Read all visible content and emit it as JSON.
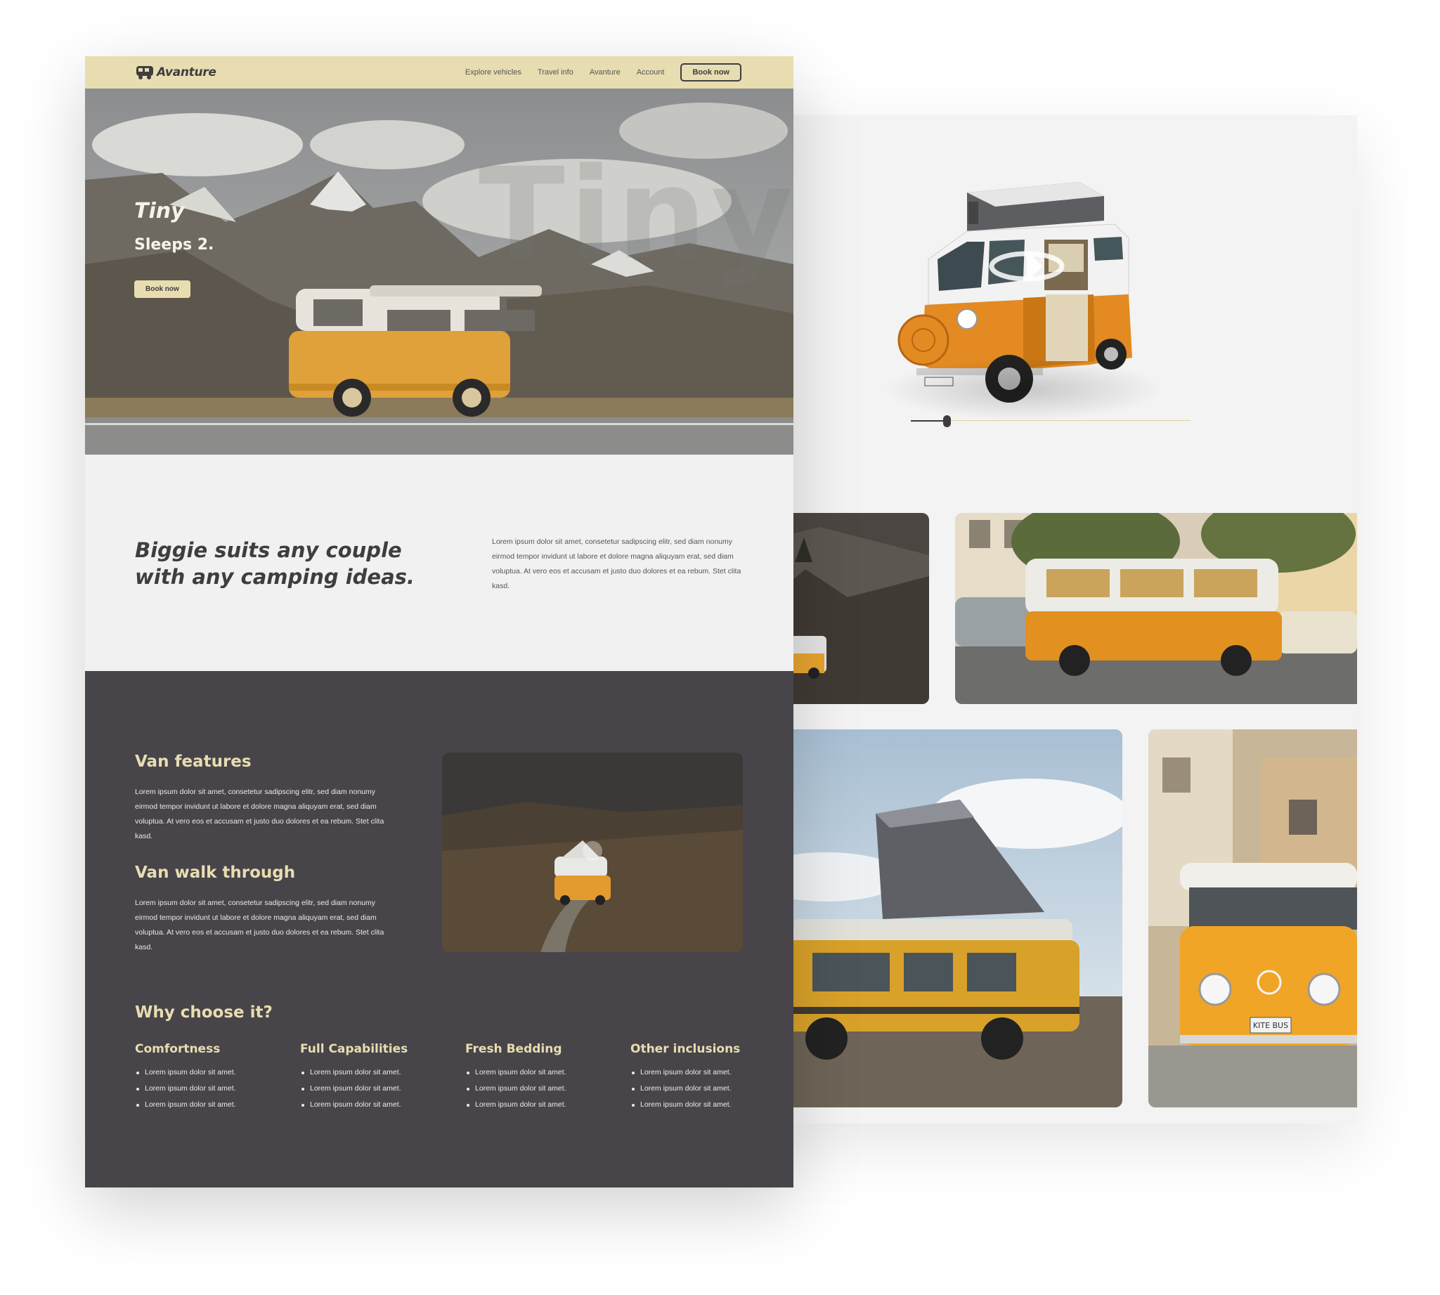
{
  "brand": {
    "name": "Avanture",
    "icon": "camper-van-icon"
  },
  "nav": {
    "links": [
      "Explore vehicles",
      "Travel info",
      "Avanture",
      "Account"
    ],
    "cta": "Book now"
  },
  "hero": {
    "title": "Tiny",
    "subtitle": "Sleeps 2.",
    "button": "Book now",
    "watermark": "Tiny"
  },
  "intro": {
    "title": "Biggie suits any couple with any camping ideas.",
    "body": "Lorem ipsum dolor sit amet, consetetur sadipscing elitr, sed diam nonumy eirmod tempor invidunt ut labore et dolore magna aliquyam erat, sed diam voluptua. At vero eos et accusam et justo duo dolores et ea rebum. Stet clita kasd."
  },
  "features": {
    "title": "Van features",
    "body": "Lorem ipsum dolor sit amet, consetetur sadipscing elitr, sed diam nonumy eirmod tempor invidunt ut labore et dolore magna aliquyam erat, sed diam voluptua. At vero eos et accusam et justo duo dolores et ea rebum. Stet clita kasd."
  },
  "walkthrough": {
    "title": "Van walk through",
    "body": "Lorem ipsum dolor sit amet, consetetur sadipscing elitr, sed diam nonumy eirmod tempor invidunt ut labore et dolore magna aliquyam erat, sed diam voluptua. At vero eos et accusam et justo duo dolores et ea rebum. Stet clita kasd."
  },
  "why": {
    "title": "Why choose it?",
    "columns": [
      {
        "title": "Comfortness",
        "items": [
          "Lorem ipsum dolor sit amet.",
          "Lorem ipsum dolor sit amet.",
          "Lorem ipsum dolor sit amet."
        ]
      },
      {
        "title": "Full Capabilities",
        "items": [
          "Lorem ipsum dolor sit amet.",
          "Lorem ipsum dolor sit amet.",
          "Lorem ipsum dolor sit amet."
        ]
      },
      {
        "title": "Fresh Bedding",
        "items": [
          "Lorem ipsum dolor sit amet.",
          "Lorem ipsum dolor sit amet.",
          "Lorem ipsum dolor sit amet."
        ]
      },
      {
        "title": "Other inclusions",
        "items": [
          "Lorem ipsum dolor sit amet.",
          "Lorem ipsum dolor sit amet.",
          "Lorem ipsum dolor sit amet."
        ]
      }
    ]
  },
  "viewer": {
    "rotate_icon": "rotate-360-icon",
    "slider_value": 0.13
  },
  "colors": {
    "accent": "#e8ddb0",
    "dark": "#47454a",
    "van_orange": "#e39a2e",
    "text_dark": "#3f3d40"
  },
  "plates": {
    "kite_bus": "KITE BUS"
  }
}
